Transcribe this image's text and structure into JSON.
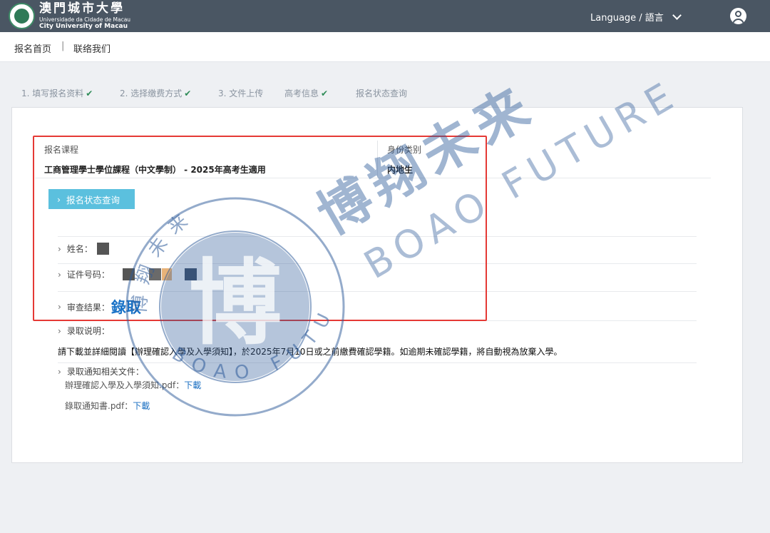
{
  "header": {
    "logo_zh": "澳門城市大學",
    "logo_pt": "Universidade da Cidade de Macau",
    "logo_en": "City University of Macau",
    "language_label": "Language / 語言"
  },
  "nav": {
    "home": "报名首页",
    "separator": "|",
    "contact": "联络我们"
  },
  "steps": [
    {
      "label": "1. 填写报名资料",
      "done": true
    },
    {
      "label": "2. 选择缴费方式",
      "done": true
    },
    {
      "label": "3. 文件上传",
      "done": false
    },
    {
      "label": "高考信息",
      "done": true
    },
    {
      "label": "报名状态查询",
      "done": false
    }
  ],
  "check_mark": "✔",
  "application": {
    "program_label": "报名课程",
    "program_value": "工商管理學士學位課程（中文學制） - 2025年高考生適用",
    "identity_label": "身份类别",
    "identity_value": "内地生",
    "status_button": "报名状态查询"
  },
  "fields": {
    "name_label": "姓名：",
    "id_label": "证件号码：",
    "result_label": "审查结果：",
    "result_value": "錄取",
    "admission_note_label": "录取说明：",
    "admission_note": "請下載並詳細閱讀【辦理確認入學及入學須知】，於2025年7月10日或之前繳費確認學籍。如逾期未確認學籍，將自動視為放棄入學。",
    "documents_label": "录取通知相关文件：",
    "documents": [
      {
        "name": "辦理確認入學及入學須知.pdf：",
        "link": "下載"
      },
      {
        "name": "錄取通知書.pdf：",
        "link": "下載"
      }
    ]
  },
  "watermark": {
    "zh_large": "博翔未来",
    "en_large": "BOAO FUTURE",
    "seal_char": "博",
    "seal_top": "博翔未来",
    "seal_bottom": "BOAO FUTURE"
  },
  "colors": {
    "header_bg": "#4a5663",
    "button_bg": "#5bc0de",
    "result_blue": "#1a73c7",
    "highlight_red": "#e53935",
    "watermark_blue": "#2c5a99"
  }
}
